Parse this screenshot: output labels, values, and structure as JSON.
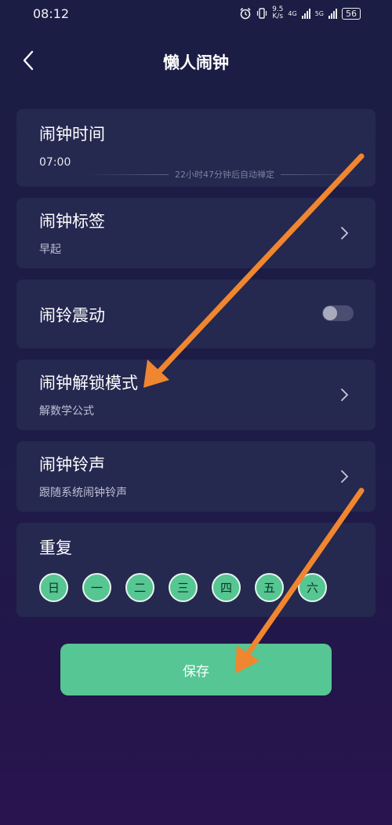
{
  "status_bar": {
    "time": "08:12",
    "net_speed_value": "9.5",
    "net_speed_unit": "K/s",
    "net_type_1": "4G",
    "net_type_2": "5G",
    "battery": "56"
  },
  "header": {
    "title": "懒人闹钟"
  },
  "alarm_time": {
    "label": "闹钟时间",
    "value": "07:00",
    "hint": "22小时47分钟后自动禅定"
  },
  "alarm_tag": {
    "label": "闹钟标签",
    "value": "早起"
  },
  "vibrate": {
    "label": "闹铃震动",
    "enabled": false
  },
  "unlock_mode": {
    "label": "闹钟解锁模式",
    "value": "解数学公式"
  },
  "ringtone": {
    "label": "闹钟铃声",
    "value": "跟随系统闹钟铃声"
  },
  "repeat": {
    "label": "重复",
    "days": [
      "日",
      "一",
      "二",
      "三",
      "四",
      "五",
      "六"
    ]
  },
  "save_label": "保存",
  "colors": {
    "background": "#1d1c48",
    "card": "#25284f",
    "accent_green": "#56c694",
    "annotation_arrow": "#f0862f"
  }
}
